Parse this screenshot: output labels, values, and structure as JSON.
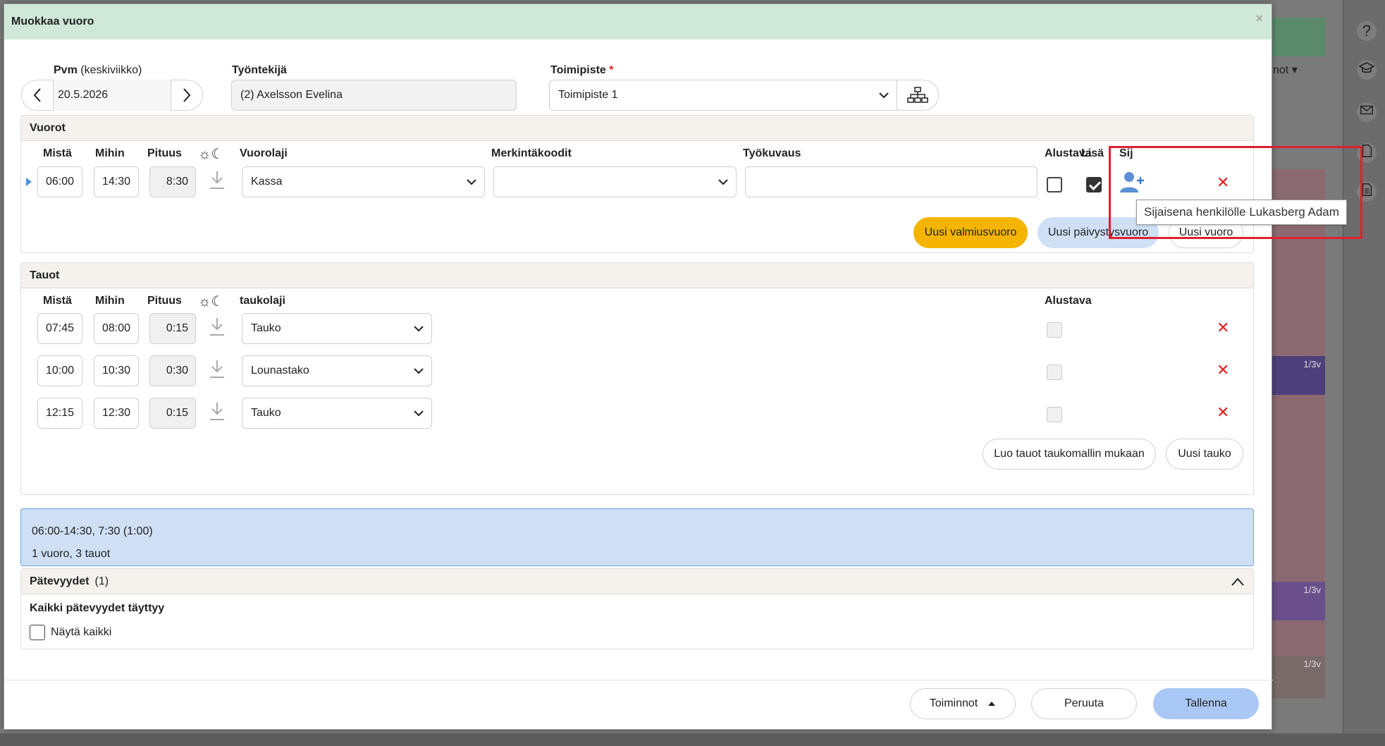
{
  "background": {
    "right_icons": [
      "question-icon",
      "graduation-cap-icon",
      "mail-icon",
      "document-icon",
      "document-lines-icon"
    ],
    "top_dropdown_label": "not",
    "purple_labels": [
      "1/3v",
      "1/3v",
      "1/3v"
    ]
  },
  "modal": {
    "title": "Muokkaa vuoro",
    "close_symbol": "×"
  },
  "header_fields": {
    "date_label": "Pvm",
    "date_weekday": "(keskiviikko)",
    "date_value": "20.5.2026",
    "employee_label": "Työntekijä",
    "employee_value": "(2) Axelsson Evelina",
    "location_label": "Toimipiste",
    "location_required": "*",
    "location_value": "Toimipiste 1"
  },
  "shifts": {
    "title": "Vuorot",
    "columns": {
      "from": "Mistä",
      "to": "Mihin",
      "length": "Pituus",
      "type": "Vuorolaji",
      "codes": "Merkintäkoodit",
      "description": "Työkuvaus",
      "preliminary": "Alustava",
      "extra": "Lisä",
      "substitute": "Sij"
    },
    "rows": [
      {
        "from": "06:00",
        "to": "14:30",
        "length": "8:30",
        "type": "Kassa",
        "codes": "",
        "description": "",
        "preliminary": false,
        "extra": true
      }
    ],
    "buttons": {
      "standby": "Uusi valmiusvuoro",
      "oncall": "Uusi päivystysvuoro",
      "new_shift": "Uusi vuoro"
    }
  },
  "breaks": {
    "title": "Tauot",
    "columns": {
      "from": "Mistä",
      "to": "Mihin",
      "length": "Pituus",
      "type": "taukolaji",
      "preliminary": "Alustava"
    },
    "rows": [
      {
        "from": "07:45",
        "to": "08:00",
        "length": "0:15",
        "type": "Tauko"
      },
      {
        "from": "10:00",
        "to": "10:30",
        "length": "0:30",
        "type": "Lounastako"
      },
      {
        "from": "12:15",
        "to": "12:30",
        "length": "0:15",
        "type": "Tauko"
      }
    ],
    "buttons": {
      "by_template": "Luo tauot taukomallin mukaan",
      "new_break": "Uusi tauko"
    }
  },
  "summary": {
    "line1": "06:00-14:30, 7:30 (1:00)",
    "line2": "1 vuoro, 3 tauot"
  },
  "qualifications": {
    "title": "Pätevyydet",
    "count": "(1)",
    "status": "Kaikki pätevyydet täyttyy",
    "show_all": "Näytä kaikki"
  },
  "tooltip": {
    "text": "Sijaisena henkilölle Lukasberg Adam"
  },
  "footer": {
    "actions": "Toiminnot",
    "cancel": "Peruuta",
    "save": "Tallenna"
  },
  "colors": {
    "header_bg": "#cfe8d8",
    "yellow": "#f5b400",
    "blue_light": "#cfe0f5",
    "primary": "#a9c8f5",
    "delete": "#e02020",
    "highlight": "#e02030"
  }
}
